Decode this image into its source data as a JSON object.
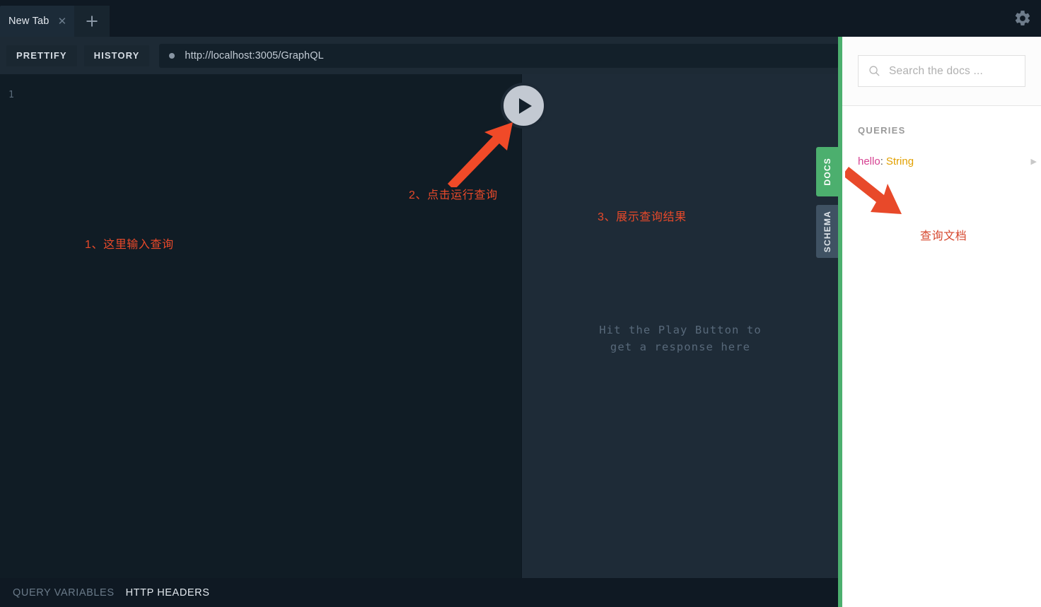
{
  "window": {
    "tab": {
      "label": "New Tab",
      "close_icon": "close-icon"
    },
    "new_tab_icon": "plus-icon",
    "settings_icon": "gear-icon"
  },
  "toolbar": {
    "prettify_label": "PRETTIFY",
    "history_label": "HISTORY",
    "url_value": "http://localhost:3005/GraphQL",
    "url_status_icon": "status-dot-icon",
    "play_icon": "play-icon"
  },
  "editor": {
    "line_number": "1",
    "content": ""
  },
  "result": {
    "placeholder_line1": "Hit the Play Button to",
    "placeholder_line2": "get a response here"
  },
  "footer": {
    "query_variables_label": "QUERY VARIABLES",
    "http_headers_label": "HTTP HEADERS"
  },
  "side_tabs": {
    "docs_label": "DOCS",
    "schema_label": "SCHEMA"
  },
  "docs": {
    "search_placeholder": "Search the docs ...",
    "search_icon": "search-icon",
    "section_title": "QUERIES",
    "fields": [
      {
        "name": "hello",
        "colon": ":",
        "type": "String",
        "caret_icon": "chevron-right-icon"
      }
    ]
  },
  "annotations": {
    "step1": "1、这里输入查询",
    "step2": "2、点击运行查询",
    "step3": "3、展示查询结果",
    "docs": "查询文档"
  },
  "colors": {
    "accent_green": "#4caf6e",
    "annotation_red": "#e8492a",
    "editor_bg": "#101c25",
    "result_bg": "#1e2b37",
    "chrome_bg": "#0f1923"
  }
}
